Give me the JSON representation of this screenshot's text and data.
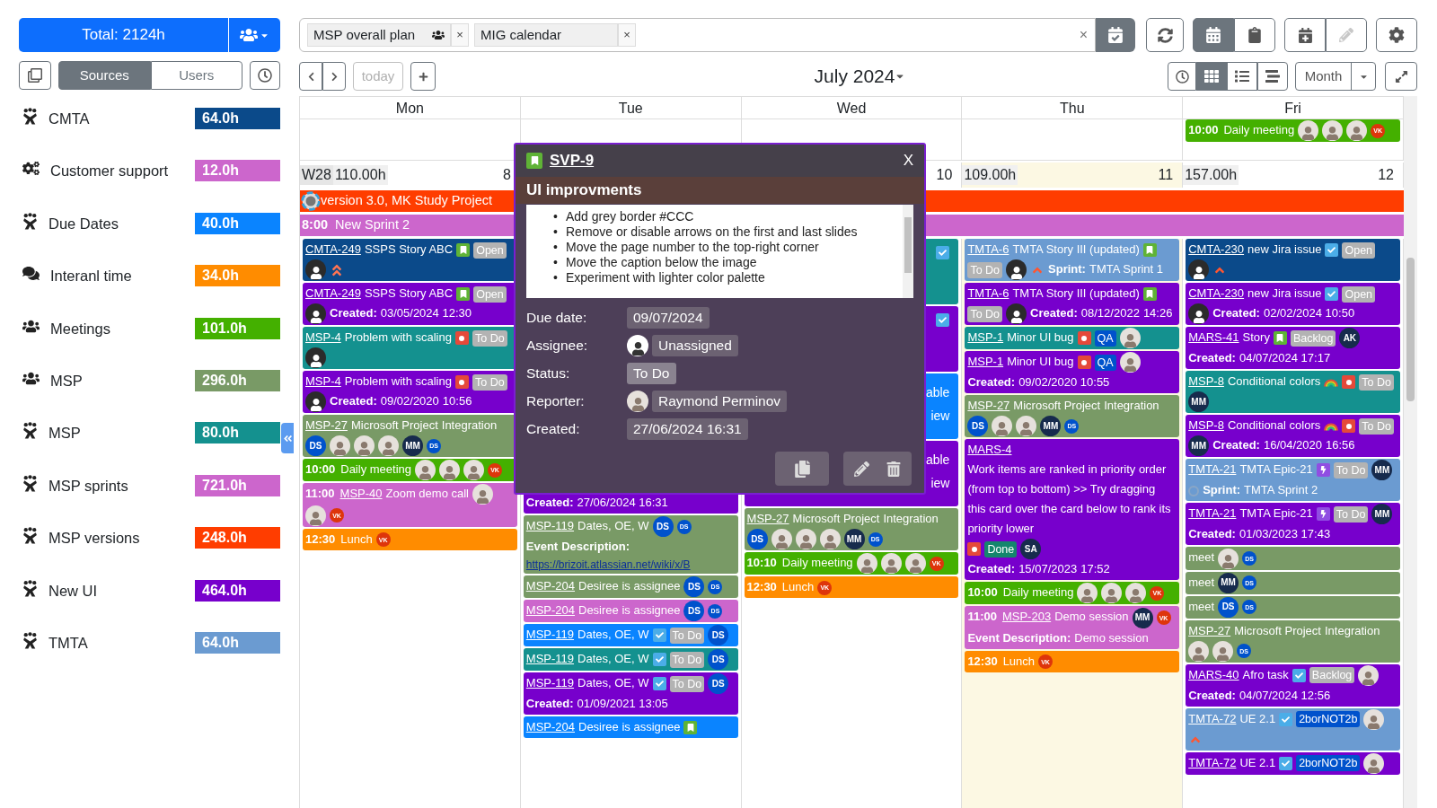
{
  "sidebar": {
    "total": "Total: 2124h",
    "toggle": [
      {
        "label": "Sources",
        "selected": true
      },
      {
        "label": "Users",
        "selected": false
      }
    ],
    "sources": [
      {
        "name": "CMTA",
        "hours": "64.0h",
        "color": "#0b4a8a",
        "kind": "jira"
      },
      {
        "name": "Customer support",
        "hours": "12.0h",
        "color": "#cc66cc",
        "kind": "gears"
      },
      {
        "name": "Due Dates",
        "hours": "40.0h",
        "color": "#0a84ff",
        "kind": "jira"
      },
      {
        "name": "Interanl time",
        "hours": "34.0h",
        "color": "#ff8c00",
        "kind": "chat"
      },
      {
        "name": "Meetings",
        "hours": "101.0h",
        "color": "#44b000",
        "kind": "team"
      },
      {
        "name": "MSP",
        "hours": "296.0h",
        "color": "#799a66",
        "kind": "team"
      },
      {
        "name": "MSP",
        "hours": "80.0h",
        "color": "#14918f",
        "kind": "jira"
      },
      {
        "name": "MSP sprints",
        "hours": "721.0h",
        "color": "#cc66cc",
        "kind": "jira"
      },
      {
        "name": "MSP versions",
        "hours": "248.0h",
        "color": "#ff3d00",
        "kind": "jira"
      },
      {
        "name": "New UI",
        "hours": "464.0h",
        "color": "#7700cc",
        "kind": "jira"
      },
      {
        "name": "TMTA",
        "hours": "64.0h",
        "color": "#6b9bd1",
        "kind": "jira"
      }
    ]
  },
  "calendars": {
    "chips": [
      {
        "label": "MSP overall plan",
        "shared": true,
        "remove": "×"
      },
      {
        "label": "MIG calendar",
        "shared": false,
        "remove": "×"
      }
    ],
    "clear": "×"
  },
  "modes": [
    {
      "kind": "calendar",
      "selected": true
    },
    {
      "kind": "clipboard",
      "selected": false
    }
  ],
  "edit_disabled": true,
  "nav": {
    "today": "today",
    "today_disabled": true,
    "title": "July 2024"
  },
  "views": [
    {
      "kind": "grid",
      "selected": true
    },
    {
      "kind": "list",
      "selected": false
    },
    {
      "kind": "timeline",
      "selected": false
    }
  ],
  "range": "Month",
  "week": "W28",
  "bars": [
    {
      "color": "#ff3d00",
      "logo": true,
      "text": "version 3.0, MK Study Project"
    },
    {
      "color": "#cc66cc",
      "logo": false,
      "time": "8:00",
      "text": "New Sprint 2"
    }
  ],
  "days": [
    {
      "name": "Mon",
      "today": false,
      "covered": false,
      "total": "110.00h",
      "number": "8",
      "cards": [
        {
          "color": "#0b4a8a",
          "parts": [
            {
              "kind": "key",
              "text": "CMTA-249"
            },
            {
              "kind": "text",
              "text": "SSPS Story ABC"
            },
            {
              "kind": "story"
            },
            {
              "kind": "tag",
              "text": "Open",
              "color": "#b3b3b3"
            },
            {
              "kind": "user"
            },
            {
              "kind": "priority-high"
            }
          ]
        },
        {
          "color": "#7700cc",
          "parts": [
            {
              "kind": "key",
              "text": "CMTA-249"
            },
            {
              "kind": "text",
              "text": "SSPS Story ABC"
            },
            {
              "kind": "story"
            },
            {
              "kind": "tag",
              "text": "Open",
              "color": "#b3b3b3"
            },
            {
              "kind": "user"
            },
            {
              "kind": "bold",
              "text": "Created:"
            },
            {
              "kind": "text",
              "text": "03/05/2024 12:30"
            }
          ]
        },
        {
          "color": "#14918f",
          "parts": [
            {
              "kind": "key",
              "text": "MSP-4"
            },
            {
              "kind": "text",
              "text": "Problem with scaling"
            },
            {
              "kind": "bug"
            },
            {
              "kind": "tag",
              "text": "To Do",
              "color": "#b3b3b3"
            },
            {
              "kind": "user"
            }
          ]
        },
        {
          "color": "#7700cc",
          "parts": [
            {
              "kind": "key",
              "text": "MSP-4"
            },
            {
              "kind": "text",
              "text": "Problem with scaling"
            },
            {
              "kind": "bug"
            },
            {
              "kind": "tag",
              "text": "To Do",
              "color": "#b3b3b3"
            },
            {
              "kind": "user"
            },
            {
              "kind": "bold",
              "text": "Created:"
            },
            {
              "kind": "text",
              "text": "09/02/2020"
            },
            {
              "kind": "text",
              "text": "10:56"
            }
          ]
        },
        {
          "color": "#799a66",
          "parts": [
            {
              "kind": "key",
              "text": "MSP-27"
            },
            {
              "kind": "text",
              "text": "Microsoft Project"
            },
            {
              "kind": "text",
              "text": "Integration"
            },
            {
              "kind": "initials",
              "text": "DS",
              "color": "#0052cc"
            },
            {
              "kind": "photo"
            },
            {
              "kind": "photo"
            },
            {
              "kind": "photo"
            },
            {
              "kind": "initials",
              "text": "MM",
              "color": "#172b4d"
            },
            {
              "kind": "mini",
              "text": "DS",
              "color": "#0052cc"
            }
          ]
        },
        {
          "color": "#44b000",
          "parts": [
            {
              "kind": "time",
              "text": "10:00"
            },
            {
              "kind": "text",
              "text": "Daily meeting"
            },
            {
              "kind": "photo"
            },
            {
              "kind": "photo"
            },
            {
              "kind": "photo"
            },
            {
              "kind": "mini",
              "text": "VK",
              "color": "#de350b"
            }
          ]
        },
        {
          "color": "#cc66cc",
          "parts": [
            {
              "kind": "time",
              "text": "11:00"
            },
            {
              "kind": "key",
              "text": "MSP-40"
            },
            {
              "kind": "text",
              "text": "Zoom demo call"
            },
            {
              "kind": "photo"
            },
            {
              "kind": "photo"
            },
            {
              "kind": "mini",
              "text": "VK",
              "color": "#de350b"
            }
          ]
        },
        {
          "color": "#ff8c00",
          "parts": [
            {
              "kind": "time",
              "text": "12:30"
            },
            {
              "kind": "text",
              "text": "Lunch"
            },
            {
              "kind": "mini",
              "text": "VK",
              "color": "#de350b"
            }
          ]
        }
      ]
    },
    {
      "name": "Tue",
      "today": false,
      "covered": true,
      "cards": [
        {
          "color": "#7700cc",
          "parts": [
            {
              "kind": "bold",
              "text": "Created:"
            },
            {
              "kind": "text",
              "text": "27/06/2024 16:31"
            }
          ]
        },
        {
          "color": "#799a66",
          "parts": [
            {
              "kind": "key",
              "text": "MSP-119"
            },
            {
              "kind": "text",
              "text": "Dates, OE, W"
            },
            {
              "kind": "initials",
              "text": "DS",
              "color": "#0052cc"
            },
            {
              "kind": "mini",
              "text": "DS",
              "color": "#0052cc"
            },
            {
              "kind": "bold",
              "text": "Event"
            },
            {
              "kind": "bold",
              "text": "Description:"
            },
            {
              "kind": "url",
              "text": "https://brizoit.atlassian.net/wiki/x/B"
            }
          ]
        },
        {
          "color": "#799a66",
          "parts": [
            {
              "kind": "key",
              "text": "MSP-204"
            },
            {
              "kind": "text",
              "text": "Desiree is assignee"
            },
            {
              "kind": "initials",
              "text": "DS",
              "color": "#0052cc"
            },
            {
              "kind": "mini",
              "text": "DS",
              "color": "#0052cc"
            }
          ]
        },
        {
          "color": "#cc66cc",
          "parts": [
            {
              "kind": "key",
              "text": "MSP-204"
            },
            {
              "kind": "text",
              "text": "Desiree is assignee"
            },
            {
              "kind": "initials",
              "text": "DS",
              "color": "#0052cc"
            },
            {
              "kind": "mini",
              "text": "DS",
              "color": "#0052cc"
            }
          ]
        },
        {
          "color": "#0a84ff",
          "parts": [
            {
              "kind": "key",
              "text": "MSP-119"
            },
            {
              "kind": "text",
              "text": "Dates, OE, W"
            },
            {
              "kind": "check"
            },
            {
              "kind": "tag",
              "text": "To Do",
              "color": "#b3b3b3"
            },
            {
              "kind": "initials",
              "text": "DS",
              "color": "#0052cc"
            }
          ]
        },
        {
          "color": "#14918f",
          "parts": [
            {
              "kind": "key",
              "text": "MSP-119"
            },
            {
              "kind": "text",
              "text": "Dates, OE, W"
            },
            {
              "kind": "check"
            },
            {
              "kind": "tag",
              "text": "To Do",
              "color": "#b3b3b3"
            },
            {
              "kind": "initials",
              "text": "DS",
              "color": "#0052cc"
            }
          ]
        },
        {
          "color": "#7700cc",
          "parts": [
            {
              "kind": "key",
              "text": "MSP-119"
            },
            {
              "kind": "text",
              "text": "Dates, OE, W"
            },
            {
              "kind": "check"
            },
            {
              "kind": "tag",
              "text": "To Do",
              "color": "#b3b3b3"
            },
            {
              "kind": "initials",
              "text": "DS",
              "color": "#0052cc"
            },
            {
              "kind": "bold",
              "text": "Created:"
            },
            {
              "kind": "text",
              "text": "01/09/2021 13:05"
            }
          ]
        },
        {
          "color": "#0a84ff",
          "parts": [
            {
              "kind": "key",
              "text": "MSP-204"
            },
            {
              "kind": "text",
              "text": "Desiree is assignee"
            },
            {
              "kind": "story"
            }
          ]
        }
      ]
    },
    {
      "name": "Wed",
      "today": false,
      "covered": false,
      "number": "10",
      "cards": [
        {
          "kind": "peek",
          "color": "#14918f",
          "parts": [
            {
              "kind": "check"
            }
          ]
        },
        {
          "kind": "peek",
          "color": "#7700cc",
          "parts": [
            {
              "kind": "check"
            }
          ]
        },
        {
          "kind": "peek",
          "color": "#0a84ff",
          "parts": [
            {
              "kind": "text",
              "text": "able"
            },
            {
              "kind": "text",
              "text": "iew"
            }
          ]
        },
        {
          "kind": "peek",
          "color": "#7700cc",
          "parts": [
            {
              "kind": "text",
              "text": "able"
            },
            {
              "kind": "text",
              "text": "iew"
            }
          ]
        },
        {
          "color": "#799a66",
          "parts": [
            {
              "kind": "key",
              "text": "MSP-27"
            },
            {
              "kind": "text",
              "text": "Microsoft Project"
            },
            {
              "kind": "text",
              "text": "Integration"
            },
            {
              "kind": "initials",
              "text": "DS",
              "color": "#0052cc"
            },
            {
              "kind": "photo"
            },
            {
              "kind": "photo"
            },
            {
              "kind": "photo"
            },
            {
              "kind": "initials",
              "text": "MM",
              "color": "#172b4d"
            },
            {
              "kind": "mini",
              "text": "DS",
              "color": "#0052cc"
            }
          ]
        },
        {
          "color": "#44b000",
          "parts": [
            {
              "kind": "time",
              "text": "10:10"
            },
            {
              "kind": "text",
              "text": "Daily meeting"
            },
            {
              "kind": "photo"
            },
            {
              "kind": "photo"
            },
            {
              "kind": "photo"
            },
            {
              "kind": "mini",
              "text": "VK",
              "color": "#de350b"
            }
          ]
        },
        {
          "color": "#ff8c00",
          "parts": [
            {
              "kind": "time",
              "text": "12:30"
            },
            {
              "kind": "text",
              "text": "Lunch"
            },
            {
              "kind": "mini",
              "text": "VK",
              "color": "#de350b"
            }
          ]
        }
      ]
    },
    {
      "name": "Thu",
      "today": true,
      "covered": false,
      "total": "109.00h",
      "number": "11",
      "cards": [
        {
          "color": "#6b9bd1",
          "parts": [
            {
              "kind": "key",
              "text": "TMTA-6"
            },
            {
              "kind": "text",
              "text": "TMTA Story III (updated)"
            },
            {
              "kind": "story"
            },
            {
              "kind": "tag",
              "text": "To Do",
              "color": "#b3b3b3"
            },
            {
              "kind": "user"
            },
            {
              "kind": "priority-up"
            },
            {
              "kind": "bold",
              "text": "Sprint:"
            },
            {
              "kind": "text",
              "text": "TMTA Sprint 1"
            }
          ]
        },
        {
          "color": "#7700cc",
          "parts": [
            {
              "kind": "key",
              "text": "TMTA-6"
            },
            {
              "kind": "text",
              "text": "TMTA Story III (updated)"
            },
            {
              "kind": "story"
            },
            {
              "kind": "tag",
              "text": "To Do",
              "color": "#b3b3b3"
            },
            {
              "kind": "user"
            },
            {
              "kind": "bold",
              "text": "Created:"
            },
            {
              "kind": "text",
              "text": "08/12/2022"
            },
            {
              "kind": "text",
              "text": "14:26"
            }
          ]
        },
        {
          "color": "#14918f",
          "parts": [
            {
              "kind": "key",
              "text": "MSP-1"
            },
            {
              "kind": "text",
              "text": "Minor UI bug"
            },
            {
              "kind": "bug"
            },
            {
              "kind": "tag",
              "text": "QA",
              "color": "#0052cc"
            },
            {
              "kind": "photo"
            }
          ]
        },
        {
          "color": "#7700cc",
          "parts": [
            {
              "kind": "key",
              "text": "MSP-1"
            },
            {
              "kind": "text",
              "text": "Minor UI bug"
            },
            {
              "kind": "bug"
            },
            {
              "kind": "tag",
              "text": "QA",
              "color": "#0052cc"
            },
            {
              "kind": "photo"
            },
            {
              "kind": "bold",
              "text": "Created:"
            },
            {
              "kind": "text",
              "text": "09/02/2020 10:55"
            }
          ]
        },
        {
          "color": "#799a66",
          "parts": [
            {
              "kind": "key",
              "text": "MSP-27"
            },
            {
              "kind": "text",
              "text": "Microsoft Project"
            },
            {
              "kind": "text",
              "text": "Integration"
            },
            {
              "kind": "initials",
              "text": "DS",
              "color": "#0052cc"
            },
            {
              "kind": "photo"
            },
            {
              "kind": "photo"
            },
            {
              "kind": "initials",
              "text": "MM",
              "color": "#172b4d"
            },
            {
              "kind": "mini",
              "text": "DS",
              "color": "#0052cc"
            }
          ]
        },
        {
          "color": "#7700cc",
          "parts": [
            {
              "kind": "key",
              "text": "MARS-4"
            },
            {
              "kind": "longtext",
              "text": "Work items are ranked in priority order (from top to bottom) >> Try dragging this card over the card below to rank its priority lower"
            },
            {
              "kind": "bug"
            },
            {
              "kind": "tag",
              "text": "Done",
              "color": "#14866d"
            },
            {
              "kind": "initials",
              "text": "SA",
              "color": "#172b4d"
            },
            {
              "kind": "bold",
              "text": "Created:"
            },
            {
              "kind": "text",
              "text": "15/07/2023"
            },
            {
              "kind": "text",
              "text": "17:52"
            }
          ]
        },
        {
          "color": "#44b000",
          "parts": [
            {
              "kind": "time",
              "text": "10:00"
            },
            {
              "kind": "text",
              "text": "Daily meeting"
            },
            {
              "kind": "photo"
            },
            {
              "kind": "photo"
            },
            {
              "kind": "photo"
            },
            {
              "kind": "mini",
              "text": "VK",
              "color": "#de350b"
            }
          ]
        },
        {
          "color": "#cc66cc",
          "parts": [
            {
              "kind": "time",
              "text": "11:00"
            },
            {
              "kind": "key",
              "text": "MSP-203"
            },
            {
              "kind": "text",
              "text": "Demo session"
            },
            {
              "kind": "initials",
              "text": "MM",
              "color": "#172b4d"
            },
            {
              "kind": "mini",
              "text": "VK",
              "color": "#de350b"
            },
            {
              "kind": "bold",
              "text": "Event Description:"
            },
            {
              "kind": "text",
              "text": "Demo session"
            }
          ]
        },
        {
          "color": "#ff8c00",
          "parts": [
            {
              "kind": "time",
              "text": "12:30"
            },
            {
              "kind": "text",
              "text": "Lunch"
            },
            {
              "kind": "mini",
              "text": "VK",
              "color": "#de350b"
            }
          ]
        }
      ]
    },
    {
      "name": "Fri",
      "today": false,
      "covered": false,
      "total": "157.00h",
      "number": "12",
      "allday": [
        {
          "color": "#44b000",
          "parts": [
            {
              "kind": "time",
              "text": "10:00"
            },
            {
              "kind": "text",
              "text": "Daily meeting"
            },
            {
              "kind": "photo"
            },
            {
              "kind": "photo"
            },
            {
              "kind": "photo"
            },
            {
              "kind": "mini",
              "text": "VK",
              "color": "#de350b"
            }
          ]
        }
      ],
      "cards": [
        {
          "color": "#0b4a8a",
          "parts": [
            {
              "kind": "key",
              "text": "CMTA-230"
            },
            {
              "kind": "text",
              "text": "new Jira issue"
            },
            {
              "kind": "check"
            },
            {
              "kind": "tag",
              "text": "Open",
              "color": "#b3b3b3"
            },
            {
              "kind": "user"
            },
            {
              "kind": "priority-up"
            }
          ]
        },
        {
          "color": "#7700cc",
          "parts": [
            {
              "kind": "key",
              "text": "CMTA-230"
            },
            {
              "kind": "text",
              "text": "new Jira issue"
            },
            {
              "kind": "check"
            },
            {
              "kind": "tag",
              "text": "Open",
              "color": "#b3b3b3"
            },
            {
              "kind": "user"
            },
            {
              "kind": "bold",
              "text": "Created:"
            },
            {
              "kind": "text",
              "text": "02/02/2024 10:50"
            }
          ]
        },
        {
          "color": "#7700cc",
          "parts": [
            {
              "kind": "key",
              "text": "MARS-41"
            },
            {
              "kind": "text",
              "text": "Story"
            },
            {
              "kind": "story"
            },
            {
              "kind": "tag",
              "text": "Backlog",
              "color": "#b3b3b3"
            },
            {
              "kind": "initials",
              "text": "AK",
              "color": "#172b4d"
            },
            {
              "kind": "bold",
              "text": "Created:"
            },
            {
              "kind": "text",
              "text": "04/07/2024 17:17"
            }
          ]
        },
        {
          "color": "#14918f",
          "parts": [
            {
              "kind": "key",
              "text": "MSP-8"
            },
            {
              "kind": "text",
              "text": "Conditional colors"
            },
            {
              "kind": "rainbow"
            },
            {
              "kind": "bug"
            },
            {
              "kind": "tag",
              "text": "To Do",
              "color": "#b3b3b3"
            },
            {
              "kind": "initials",
              "text": "MM",
              "color": "#172b4d"
            }
          ]
        },
        {
          "color": "#7700cc",
          "parts": [
            {
              "kind": "key",
              "text": "MSP-8"
            },
            {
              "kind": "text",
              "text": "Conditional colors"
            },
            {
              "kind": "rainbow"
            },
            {
              "kind": "bug"
            },
            {
              "kind": "tag",
              "text": "To Do",
              "color": "#b3b3b3"
            },
            {
              "kind": "initials",
              "text": "MM",
              "color": "#172b4d"
            },
            {
              "kind": "bold",
              "text": "Created:"
            },
            {
              "kind": "text",
              "text": "16/04/2020"
            },
            {
              "kind": "text",
              "text": "16:56"
            }
          ]
        },
        {
          "color": "#6b9bd1",
          "parts": [
            {
              "kind": "key",
              "text": "TMTA-21"
            },
            {
              "kind": "text",
              "text": "TMTA Epic-21"
            },
            {
              "kind": "epic"
            },
            {
              "kind": "tag",
              "text": "To Do",
              "color": "#b3b3b3"
            },
            {
              "kind": "initials",
              "text": "MM",
              "color": "#172b4d"
            },
            {
              "kind": "sprint"
            },
            {
              "kind": "bold",
              "text": "Sprint:"
            },
            {
              "kind": "text",
              "text": "TMTA Sprint 2"
            }
          ]
        },
        {
          "color": "#7700cc",
          "parts": [
            {
              "kind": "key",
              "text": "TMTA-21"
            },
            {
              "kind": "text",
              "text": "TMTA Epic-21"
            },
            {
              "kind": "epic"
            },
            {
              "kind": "tag",
              "text": "To Do",
              "color": "#b3b3b3"
            },
            {
              "kind": "initials",
              "text": "MM",
              "color": "#172b4d"
            },
            {
              "kind": "bold",
              "text": "Created:"
            },
            {
              "kind": "text",
              "text": "01/03/2023 17:43"
            }
          ]
        },
        {
          "color": "#799a66",
          "parts": [
            {
              "kind": "text",
              "text": "meet"
            },
            {
              "kind": "photo"
            },
            {
              "kind": "mini",
              "text": "DS",
              "color": "#0052cc"
            }
          ]
        },
        {
          "color": "#799a66",
          "parts": [
            {
              "kind": "text",
              "text": "meet"
            },
            {
              "kind": "initials",
              "text": "MM",
              "color": "#172b4d"
            },
            {
              "kind": "mini",
              "text": "DS",
              "color": "#0052cc"
            }
          ]
        },
        {
          "color": "#799a66",
          "parts": [
            {
              "kind": "text",
              "text": "meet"
            },
            {
              "kind": "initials",
              "text": "DS",
              "color": "#0052cc"
            },
            {
              "kind": "mini",
              "text": "DS",
              "color": "#0052cc"
            }
          ]
        },
        {
          "color": "#799a66",
          "parts": [
            {
              "kind": "key",
              "text": "MSP-27"
            },
            {
              "kind": "text",
              "text": "Microsoft Project"
            },
            {
              "kind": "text",
              "text": "Integration"
            },
            {
              "kind": "photo"
            },
            {
              "kind": "photo"
            },
            {
              "kind": "mini",
              "text": "DS",
              "color": "#0052cc"
            }
          ]
        },
        {
          "color": "#7700cc",
          "parts": [
            {
              "kind": "key",
              "text": "MARS-40"
            },
            {
              "kind": "text",
              "text": "Afro task"
            },
            {
              "kind": "check"
            },
            {
              "kind": "tag",
              "text": "Backlog",
              "color": "#b3b3b3"
            },
            {
              "kind": "photo"
            },
            {
              "kind": "bold",
              "text": "Created:"
            },
            {
              "kind": "text",
              "text": "04/07/2024 12:56"
            }
          ]
        },
        {
          "color": "#6b9bd1",
          "parts": [
            {
              "kind": "key",
              "text": "TMTA-72"
            },
            {
              "kind": "text",
              "text": "UE 2.1"
            },
            {
              "kind": "check"
            },
            {
              "kind": "tag",
              "text": "2borNOT2b",
              "color": "#0052cc"
            },
            {
              "kind": "photo"
            },
            {
              "kind": "priority-up"
            }
          ]
        },
        {
          "color": "#7700cc",
          "parts": [
            {
              "kind": "key",
              "text": "TMTA-72"
            },
            {
              "kind": "text",
              "text": "UE 2.1"
            },
            {
              "kind": "check"
            },
            {
              "kind": "tag",
              "text": "2borNOT2b",
              "color": "#0052cc"
            },
            {
              "kind": "photo"
            }
          ]
        }
      ]
    }
  ],
  "popup": {
    "key": "SVP-9",
    "close": "X",
    "title": "UI improvments",
    "description": [
      {
        "marker": "•",
        "text": "Add grey border #CCC"
      },
      {
        "marker": "•",
        "text": "Remove or disable arrows on the first and last slides"
      },
      {
        "marker": "•",
        "text": "Move the page number to the top-right corner"
      },
      {
        "marker": "•",
        "text": "Move the caption below the image"
      },
      {
        "marker": "•",
        "text": "Experiment with lighter color palette"
      }
    ],
    "fields": [
      {
        "label": "Due date:",
        "value": "09/07/2024",
        "kind": "text"
      },
      {
        "label": "Assignee:",
        "value": "Unassigned",
        "kind": "user"
      },
      {
        "label": "Status:",
        "value": "To Do",
        "kind": "tag"
      },
      {
        "label": "Reporter:",
        "value": "Raymond Perminov",
        "kind": "photo"
      },
      {
        "label": "Created:",
        "value": "27/06/2024 16:31",
        "kind": "text"
      }
    ]
  }
}
